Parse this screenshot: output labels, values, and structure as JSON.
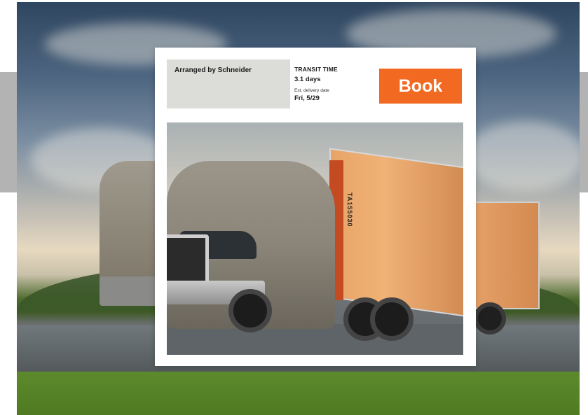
{
  "card": {
    "arranged_by": "Arranged by Schneider",
    "transit_label": "TRANSIT TIME",
    "transit_value": "3.1 days",
    "delivery_label": "Est. delivery date",
    "delivery_value": "Fri, 5/29",
    "book_label": "Book"
  },
  "truck": {
    "trailer_number": "TA155030"
  },
  "colors": {
    "accent": "#f26a21",
    "label_box": "#dcdcd9",
    "side_bar": "#b3b3b3"
  }
}
